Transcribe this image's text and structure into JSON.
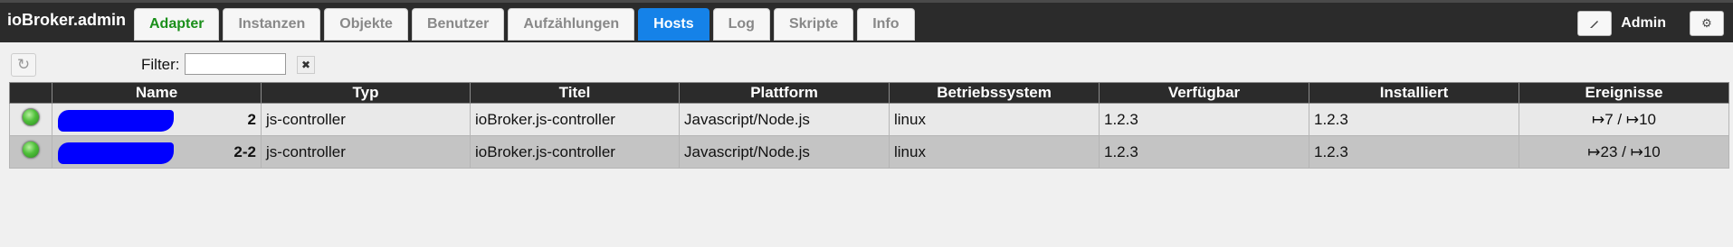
{
  "app": {
    "title": "ioBroker.admin"
  },
  "tabs": [
    {
      "label": "Adapter",
      "state": "green"
    },
    {
      "label": "Instanzen",
      "state": "normal"
    },
    {
      "label": "Objekte",
      "state": "normal"
    },
    {
      "label": "Benutzer",
      "state": "normal"
    },
    {
      "label": "Aufzählungen",
      "state": "normal"
    },
    {
      "label": "Hosts",
      "state": "active"
    },
    {
      "label": "Log",
      "state": "normal"
    },
    {
      "label": "Skripte",
      "state": "normal"
    },
    {
      "label": "Info",
      "state": "normal"
    }
  ],
  "header": {
    "user": "Admin",
    "edit_icon": "pencil-icon",
    "settings_icon": "gear-icon"
  },
  "toolbar": {
    "refresh_icon": "refresh-icon",
    "filter_label": "Filter:",
    "filter_value": "",
    "clear_icon": "✖"
  },
  "table": {
    "columns": [
      "",
      "Name",
      "Typ",
      "Titel",
      "Plattform",
      "Betriebssystem",
      "Verfügbar",
      "Installiert",
      "Ereignisse"
    ],
    "rows": [
      {
        "status": "online",
        "name_visible": "2",
        "type": "js-controller",
        "title": "ioBroker.js-controller",
        "platform": "Javascript/Node.js",
        "os": "linux",
        "available": "1.2.3",
        "installed": "1.2.3",
        "events": "↦7 / ↦10"
      },
      {
        "status": "online",
        "name_visible": "2-2",
        "type": "js-controller",
        "title": "ioBroker.js-controller",
        "platform": "Javascript/Node.js",
        "os": "linux",
        "available": "1.2.3",
        "installed": "1.2.3",
        "events": "↦23 / ↦10"
      }
    ]
  },
  "colors": {
    "topbar": "#2b2b2b",
    "active_tab": "#1582e8",
    "adapter_tab_text": "#1a8f1a",
    "redaction": "#0000ff"
  }
}
